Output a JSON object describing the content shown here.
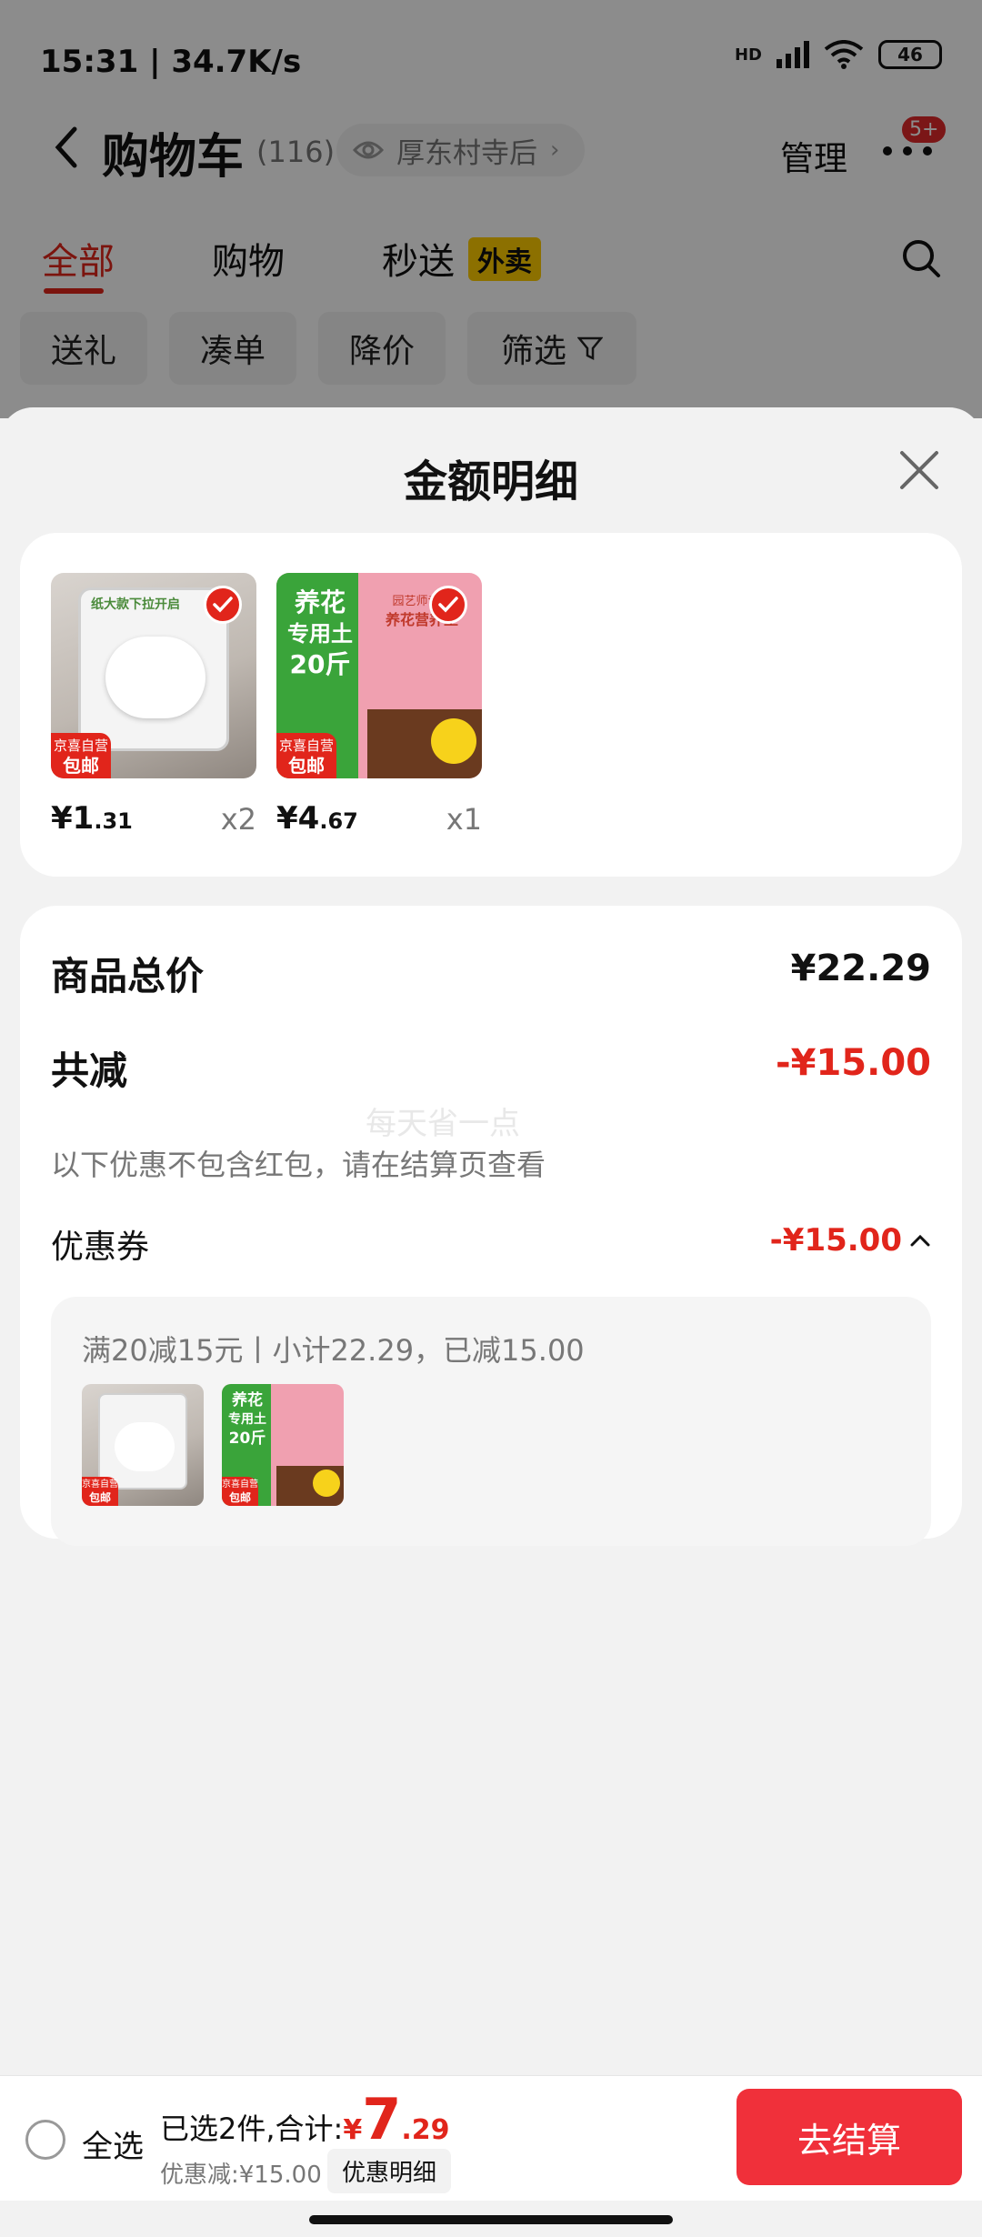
{
  "status_bar": {
    "time_speed": "15:31 | 34.7K/s",
    "network": "HD",
    "battery": "46"
  },
  "header": {
    "title": "购物车",
    "count": "(116)",
    "location": "厚东村寺后",
    "manage": "管理",
    "badge": "5+"
  },
  "tabs": [
    {
      "label": "全部",
      "active": true
    },
    {
      "label": "购物"
    },
    {
      "label": "秒送",
      "tag": "外卖"
    }
  ],
  "chips": [
    "送礼",
    "凑单",
    "降价",
    "筛选"
  ],
  "sheet": {
    "title": "金额明细",
    "products": [
      {
        "price_int": "¥1",
        "price_dec": ".31",
        "qty": "x2",
        "ship_line1": "京喜自营",
        "ship_line2": "包邮",
        "image_text": "纸大款下拉开启"
      },
      {
        "price_int": "¥4",
        "price_dec": ".67",
        "qty": "x1",
        "ship_line1": "京喜自营",
        "ship_line2": "包邮",
        "image_text_1": "养花",
        "image_text_2": "专用土",
        "image_text_3": "20斤",
        "image_text_4": "园艺师专用",
        "image_text_5": "养花营养土"
      }
    ],
    "summary": {
      "total_label": "商品总价",
      "total_value": "¥22.29",
      "reduce_label": "共减",
      "reduce_value": "-¥15.00",
      "note": "以下优惠不包含红包，请在结算页查看",
      "watermark": "每天省一点",
      "coupon_label": "优惠券",
      "coupon_value": "-¥15.00",
      "coupon_desc": "满20减15元丨小计22.29，已减15.00"
    }
  },
  "bottom_bar": {
    "select_all": "全选",
    "selected_text": "已选2件,合计:",
    "yen": "¥",
    "total_int": "7",
    "total_dec": ".29",
    "discount": "优惠减:¥15.00",
    "detail": "优惠明细",
    "checkout": "去结算"
  },
  "colors": {
    "accent": "#e1251b",
    "checkout": "#f0303a",
    "tag_yellow": "#ffcc00"
  }
}
